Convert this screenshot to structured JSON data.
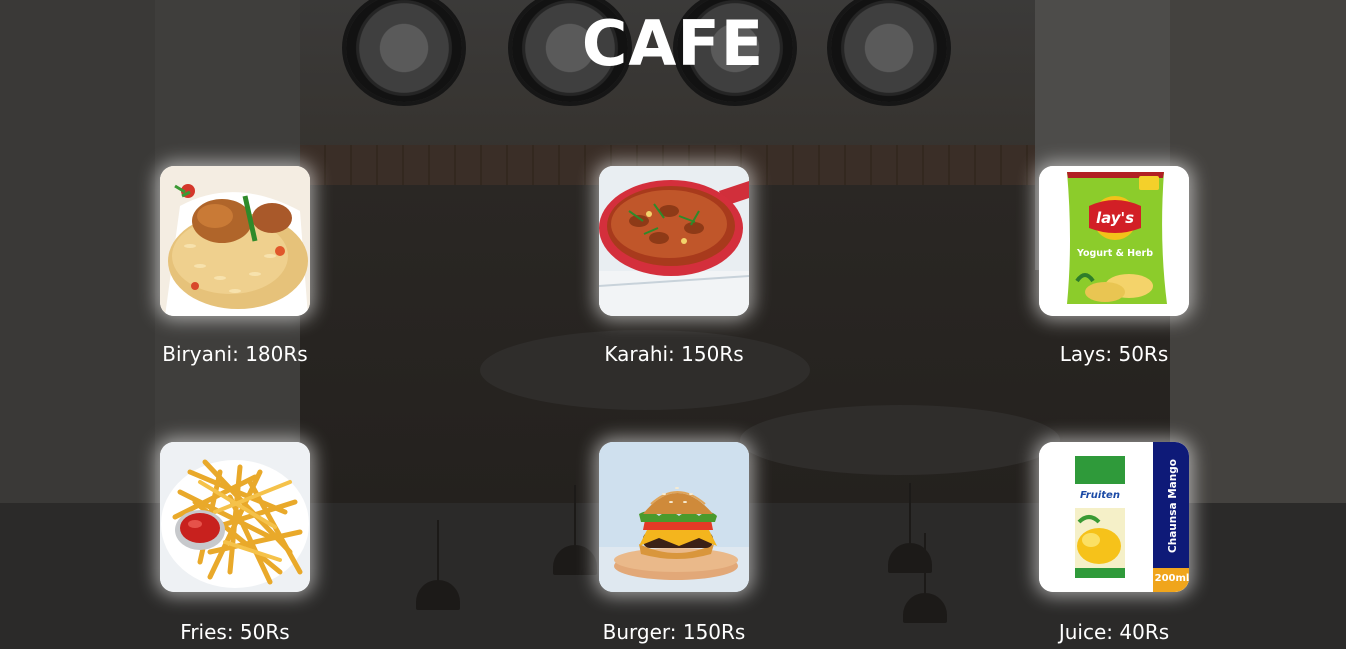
{
  "page": {
    "title": "CAFE"
  },
  "menu": {
    "items": [
      {
        "label": "Biryani: 180Rs",
        "image": "biryani-image"
      },
      {
        "label": "Karahi: 150Rs",
        "image": "karahi-image"
      },
      {
        "label": "Lays: 50Rs",
        "image": "lays-chips-image"
      },
      {
        "label": "Fries: 50Rs",
        "image": "fries-image"
      },
      {
        "label": "Burger: 150Rs",
        "image": "burger-image"
      },
      {
        "label": "Juice: 40Rs",
        "image": "juice-box-image"
      }
    ]
  },
  "product_art": {
    "lays_logo": "lay's",
    "lays_flavor": "Yogurt & Herb",
    "juice_brand": "Fruiten",
    "juice_flavor": "Chaunsa Mango",
    "juice_volume": "200ml"
  },
  "colors": {
    "title": "#ffffff",
    "label": "#ffffff",
    "glow": "#ffffff",
    "background": "#2b2a29"
  }
}
